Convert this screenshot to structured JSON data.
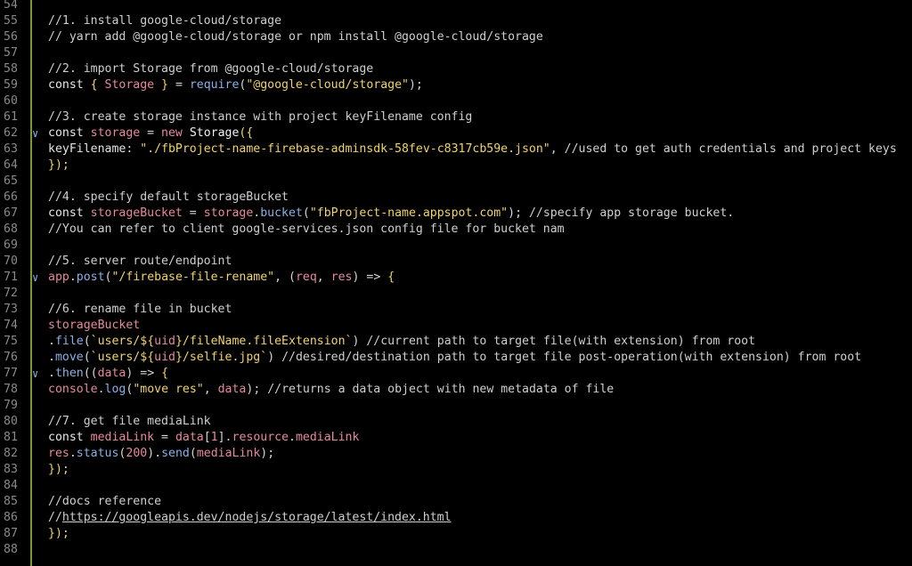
{
  "editor": {
    "theme": {
      "background": "#000000",
      "gutter_border": "#7a9a2c",
      "line_number": "#8a8a8a",
      "comment": "#cfcfcf",
      "string": "#f0d36a",
      "variable": "#e7899b",
      "function": "#8ab0e6"
    },
    "fold_icon": "chevron-down-icon",
    "lines": [
      {
        "n": "54",
        "fold": false,
        "tokens": []
      },
      {
        "n": "55",
        "fold": false,
        "tokens": [
          {
            "t": "//1. install google-cloud/storage",
            "c": "comment"
          }
        ]
      },
      {
        "n": "56",
        "fold": false,
        "tokens": [
          {
            "t": "// yarn add @google-cloud/storage or npm install @google-cloud/storage",
            "c": "comment"
          }
        ]
      },
      {
        "n": "57",
        "fold": false,
        "tokens": []
      },
      {
        "n": "58",
        "fold": false,
        "tokens": [
          {
            "t": "//2. import Storage from @google-cloud/storage",
            "c": "comment"
          }
        ]
      },
      {
        "n": "59",
        "fold": false,
        "tokens": [
          {
            "t": "const ",
            "c": "kw"
          },
          {
            "t": "{ ",
            "c": "brace"
          },
          {
            "t": "Storage",
            "c": "var"
          },
          {
            "t": " }",
            "c": "brace"
          },
          {
            "t": " = ",
            "c": "punc"
          },
          {
            "t": "require",
            "c": "fn"
          },
          {
            "t": "(",
            "c": "punc"
          },
          {
            "t": "\"@google-cloud/storage\"",
            "c": "str"
          },
          {
            "t": ");",
            "c": "punc"
          }
        ]
      },
      {
        "n": "60",
        "fold": false,
        "tokens": []
      },
      {
        "n": "61",
        "fold": false,
        "tokens": [
          {
            "t": "//3. create storage instance with project keyFilename config",
            "c": "comment"
          }
        ]
      },
      {
        "n": "62",
        "fold": true,
        "tokens": [
          {
            "t": "const ",
            "c": "kw"
          },
          {
            "t": "storage",
            "c": "var"
          },
          {
            "t": " = ",
            "c": "punc"
          },
          {
            "t": "new ",
            "c": "var"
          },
          {
            "t": "Storage",
            "c": "cls"
          },
          {
            "t": "({",
            "c": "brace"
          }
        ]
      },
      {
        "n": "63",
        "fold": false,
        "tokens": [
          {
            "t": "keyFilename",
            "c": "plain"
          },
          {
            "t": ": ",
            "c": "punc"
          },
          {
            "t": "\"./fbProject-name-firebase-adminsdk-58fev-c8317cb59e.json\"",
            "c": "str"
          },
          {
            "t": ", ",
            "c": "punc"
          },
          {
            "t": "//used to get auth credentials and project keys",
            "c": "comment"
          }
        ]
      },
      {
        "n": "64",
        "fold": false,
        "tokens": [
          {
            "t": "});",
            "c": "brace"
          }
        ]
      },
      {
        "n": "65",
        "fold": false,
        "tokens": []
      },
      {
        "n": "66",
        "fold": false,
        "tokens": [
          {
            "t": "//4. specify default storageBucket",
            "c": "comment"
          }
        ]
      },
      {
        "n": "67",
        "fold": false,
        "tokens": [
          {
            "t": "const ",
            "c": "kw"
          },
          {
            "t": "storageBucket",
            "c": "var"
          },
          {
            "t": " = ",
            "c": "punc"
          },
          {
            "t": "storage",
            "c": "var"
          },
          {
            "t": ".",
            "c": "punc"
          },
          {
            "t": "bucket",
            "c": "fn"
          },
          {
            "t": "(",
            "c": "punc"
          },
          {
            "t": "\"fbProject-name.appspot.com\"",
            "c": "str"
          },
          {
            "t": "); ",
            "c": "punc"
          },
          {
            "t": "//specify app storage bucket.",
            "c": "comment"
          }
        ]
      },
      {
        "n": "68",
        "fold": false,
        "tokens": [
          {
            "t": "//You can refer to client google-services.json config file for bucket nam",
            "c": "comment"
          }
        ]
      },
      {
        "n": "69",
        "fold": false,
        "tokens": []
      },
      {
        "n": "70",
        "fold": false,
        "tokens": [
          {
            "t": "//5. server route/endpoint",
            "c": "comment"
          }
        ]
      },
      {
        "n": "71",
        "fold": true,
        "tokens": [
          {
            "t": "app",
            "c": "var"
          },
          {
            "t": ".",
            "c": "punc"
          },
          {
            "t": "post",
            "c": "fn"
          },
          {
            "t": "(",
            "c": "punc"
          },
          {
            "t": "\"/firebase-file-rename\"",
            "c": "str"
          },
          {
            "t": ", (",
            "c": "punc"
          },
          {
            "t": "req",
            "c": "var"
          },
          {
            "t": ", ",
            "c": "punc"
          },
          {
            "t": "res",
            "c": "var"
          },
          {
            "t": ") => ",
            "c": "punc"
          },
          {
            "t": "{",
            "c": "brace"
          }
        ]
      },
      {
        "n": "72",
        "fold": false,
        "tokens": []
      },
      {
        "n": "73",
        "fold": false,
        "tokens": [
          {
            "t": "//6. rename file in bucket",
            "c": "comment"
          }
        ]
      },
      {
        "n": "74",
        "fold": false,
        "tokens": [
          {
            "t": "storageBucket",
            "c": "var"
          }
        ]
      },
      {
        "n": "75",
        "fold": false,
        "tokens": [
          {
            "t": ".",
            "c": "punc"
          },
          {
            "t": "file",
            "c": "fn"
          },
          {
            "t": "(",
            "c": "punc"
          },
          {
            "t": "`users/${",
            "c": "str"
          },
          {
            "t": "uid",
            "c": "var"
          },
          {
            "t": "}/fileName.fileExtension`",
            "c": "str"
          },
          {
            "t": ") ",
            "c": "punc"
          },
          {
            "t": "//current path to target file(with extension) from root",
            "c": "comment"
          }
        ]
      },
      {
        "n": "76",
        "fold": false,
        "tokens": [
          {
            "t": ".",
            "c": "punc"
          },
          {
            "t": "move",
            "c": "fn"
          },
          {
            "t": "(",
            "c": "punc"
          },
          {
            "t": "`users/${",
            "c": "str"
          },
          {
            "t": "uid",
            "c": "var"
          },
          {
            "t": "}/selfie.jpg`",
            "c": "str"
          },
          {
            "t": ") ",
            "c": "punc"
          },
          {
            "t": "//desired/destination path to target file post-operation(with extension) from root",
            "c": "comment"
          }
        ]
      },
      {
        "n": "77",
        "fold": true,
        "tokens": [
          {
            "t": ".",
            "c": "punc"
          },
          {
            "t": "then",
            "c": "fn"
          },
          {
            "t": "((",
            "c": "punc"
          },
          {
            "t": "data",
            "c": "var"
          },
          {
            "t": ") => ",
            "c": "punc"
          },
          {
            "t": "{",
            "c": "brace"
          }
        ]
      },
      {
        "n": "78",
        "fold": false,
        "tokens": [
          {
            "t": "console",
            "c": "var"
          },
          {
            "t": ".",
            "c": "punc"
          },
          {
            "t": "log",
            "c": "fn"
          },
          {
            "t": "(",
            "c": "punc"
          },
          {
            "t": "\"move res\"",
            "c": "str"
          },
          {
            "t": ", ",
            "c": "punc"
          },
          {
            "t": "data",
            "c": "var"
          },
          {
            "t": "); ",
            "c": "punc"
          },
          {
            "t": "//returns a data object with new metadata of file",
            "c": "comment"
          }
        ]
      },
      {
        "n": "79",
        "fold": false,
        "tokens": []
      },
      {
        "n": "80",
        "fold": false,
        "tokens": [
          {
            "t": "//7. get file mediaLink",
            "c": "comment"
          }
        ]
      },
      {
        "n": "81",
        "fold": false,
        "tokens": [
          {
            "t": "const ",
            "c": "kw"
          },
          {
            "t": "mediaLink",
            "c": "var"
          },
          {
            "t": " = ",
            "c": "punc"
          },
          {
            "t": "data",
            "c": "var"
          },
          {
            "t": "[",
            "c": "punc"
          },
          {
            "t": "1",
            "c": "num"
          },
          {
            "t": "].",
            "c": "punc"
          },
          {
            "t": "resource",
            "c": "var"
          },
          {
            "t": ".",
            "c": "punc"
          },
          {
            "t": "mediaLink",
            "c": "var"
          }
        ]
      },
      {
        "n": "82",
        "fold": false,
        "tokens": [
          {
            "t": "res",
            "c": "var"
          },
          {
            "t": ".",
            "c": "punc"
          },
          {
            "t": "status",
            "c": "fn"
          },
          {
            "t": "(",
            "c": "punc"
          },
          {
            "t": "200",
            "c": "num"
          },
          {
            "t": ").",
            "c": "punc"
          },
          {
            "t": "send",
            "c": "fn"
          },
          {
            "t": "(",
            "c": "punc"
          },
          {
            "t": "mediaLink",
            "c": "var"
          },
          {
            "t": ");",
            "c": "punc"
          }
        ]
      },
      {
        "n": "83",
        "fold": false,
        "tokens": [
          {
            "t": "});",
            "c": "brace"
          }
        ]
      },
      {
        "n": "84",
        "fold": false,
        "tokens": []
      },
      {
        "n": "85",
        "fold": false,
        "tokens": [
          {
            "t": "//docs reference",
            "c": "comment"
          }
        ]
      },
      {
        "n": "86",
        "fold": false,
        "tokens": [
          {
            "t": "//",
            "c": "comment"
          },
          {
            "t": "https://googleapis.dev/nodejs/storage/latest/index.html",
            "c": "comment link"
          }
        ]
      },
      {
        "n": "87",
        "fold": false,
        "tokens": [
          {
            "t": "});",
            "c": "brace"
          }
        ]
      },
      {
        "n": "88",
        "fold": false,
        "tokens": []
      }
    ]
  }
}
